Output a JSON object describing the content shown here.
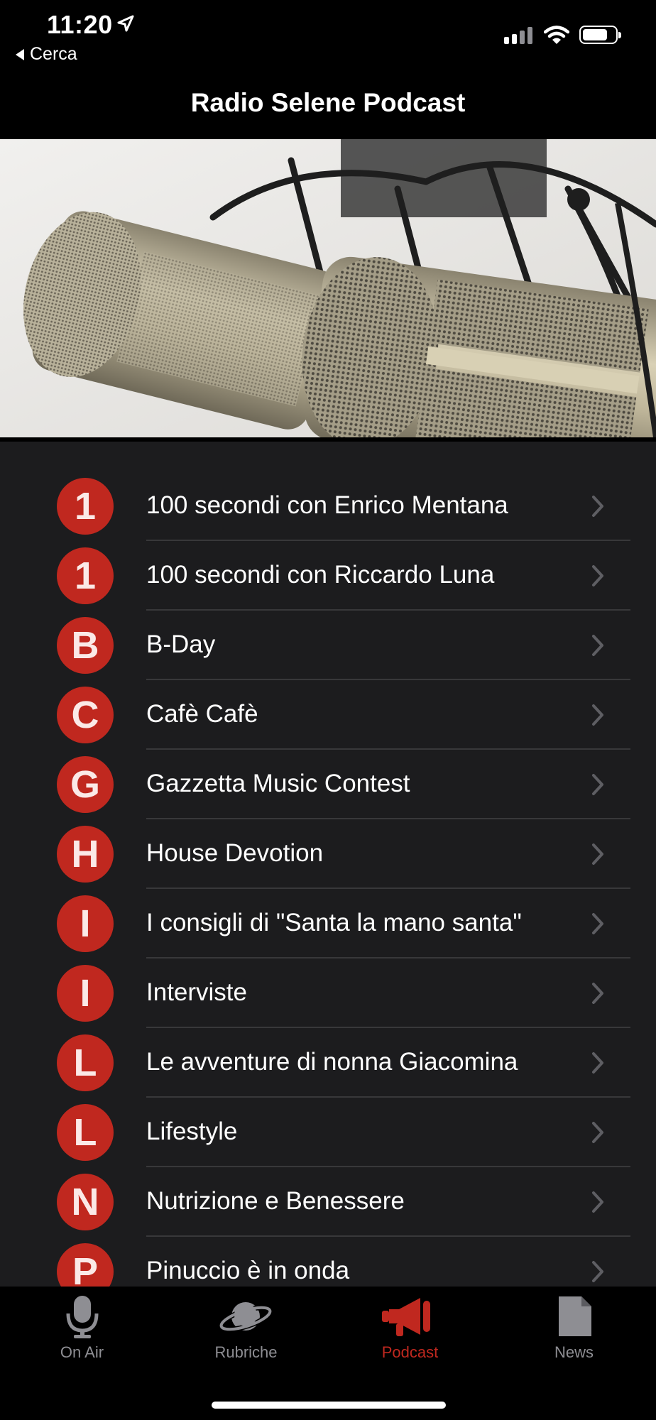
{
  "status": {
    "time": "11:20",
    "back_label": "Cerca"
  },
  "nav": {
    "title": "Radio Selene Podcast"
  },
  "podcasts": [
    {
      "letter": "1",
      "title": "100 secondi con Enrico Mentana"
    },
    {
      "letter": "1",
      "title": "100 secondi con Riccardo Luna"
    },
    {
      "letter": "B",
      "title": "B-Day"
    },
    {
      "letter": "C",
      "title": "Cafè Cafè"
    },
    {
      "letter": "G",
      "title": "Gazzetta Music Contest"
    },
    {
      "letter": "H",
      "title": "House Devotion"
    },
    {
      "letter": "I",
      "title": "I consigli di \"Santa la mano santa\""
    },
    {
      "letter": "I",
      "title": "Interviste"
    },
    {
      "letter": "L",
      "title": "Le avventure di nonna Giacomina"
    },
    {
      "letter": "L",
      "title": "Lifestyle"
    },
    {
      "letter": "N",
      "title": "Nutrizione e Benessere"
    },
    {
      "letter": "P",
      "title": "Pinuccio è in onda"
    }
  ],
  "tabs": [
    {
      "label": "On Air",
      "icon": "microphone-icon"
    },
    {
      "label": "Rubriche",
      "icon": "planet-icon"
    },
    {
      "label": "Podcast",
      "icon": "megaphone-icon",
      "active": true
    },
    {
      "label": "News",
      "icon": "document-icon"
    }
  ],
  "colors": {
    "accent": "#c0281f",
    "background": "#1c1c1e",
    "bars": "#000000",
    "inactive_tab": "#8e8e93"
  }
}
